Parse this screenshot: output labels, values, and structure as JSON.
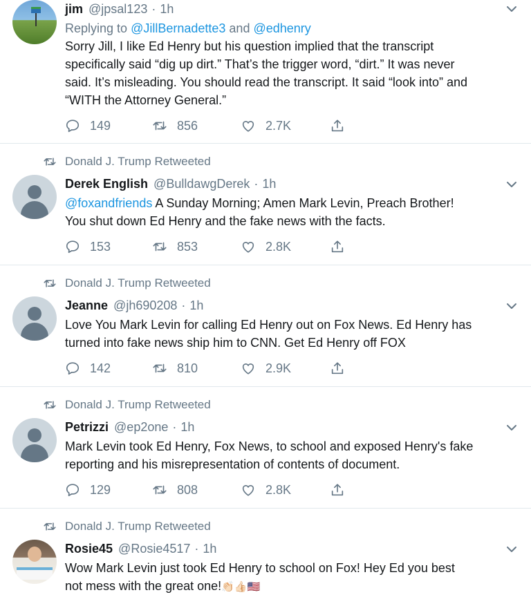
{
  "tweets": [
    {
      "retweeted_by": "",
      "name": "jim",
      "handle": "@jpsal123",
      "dot": "·",
      "time": "1h",
      "replying_prefix": "Replying to ",
      "replying_user1": "@JillBernadette3",
      "replying_and": " and ",
      "replying_user2": "@edhenry",
      "text_lines": [
        "Sorry Jill, I like Ed Henry but his question implied that the transcript",
        "specifically said “dig up dirt.” That’s the trigger word, “dirt.” It was never",
        "said. It’s misleading. You should read the transcript. It said “look into” and",
        "“WITH the Attorney General.”"
      ],
      "replies": "149",
      "retweets": "856",
      "likes": "2.7K"
    },
    {
      "retweeted_by": "Donald J. Trump Retweeted",
      "name": "Derek English",
      "handle": "@BulldawgDerek",
      "dot": "·",
      "time": "1h",
      "mention": "@foxandfriends",
      "text_line1_rest": " A Sunday Morning; Amen Mark Levin, Preach Brother!",
      "text_line2": "You shut down Ed Henry and the fake news with the facts.",
      "replies": "153",
      "retweets": "853",
      "likes": "2.8K"
    },
    {
      "retweeted_by": "Donald J. Trump Retweeted",
      "name": "Jeanne",
      "handle": "@jh690208",
      "dot": "·",
      "time": "1h",
      "text_lines": [
        "Love You Mark Levin for calling Ed Henry out on Fox News. Ed Henry has",
        "turned into fake news ship him to CNN. Get Ed Henry off FOX"
      ],
      "replies": "142",
      "retweets": "810",
      "likes": "2.9K"
    },
    {
      "retweeted_by": "Donald J. Trump Retweeted",
      "name": "Petrizzi",
      "handle": "@ep2one",
      "dot": "·",
      "time": "1h",
      "text_lines": [
        "Mark Levin took Ed Henry, Fox News, to school and exposed Henry's fake",
        "reporting and his  misrepresentation of  contents of document."
      ],
      "replies": "129",
      "retweets": "808",
      "likes": "2.8K"
    },
    {
      "retweeted_by": "Donald J. Trump Retweeted",
      "name": "Rosie45",
      "handle": "@Rosie4517",
      "dot": "·",
      "time": "1h",
      "text_line1": "Wow Mark Levin just took Ed Henry to school on Fox!  Hey Ed you best",
      "text_line2": "not mess with the great  one!",
      "emojis": "👏🏻👍🏻🇺🇸"
    }
  ],
  "icons": {
    "reply": "reply-icon",
    "retweet": "retweet-icon",
    "like": "heart-icon",
    "share": "share-icon",
    "caret": "chevron-down-icon"
  },
  "colors": {
    "link": "#1b95e0",
    "secondary": "#657786",
    "text": "#14171a",
    "divider": "#e1e8ed"
  }
}
